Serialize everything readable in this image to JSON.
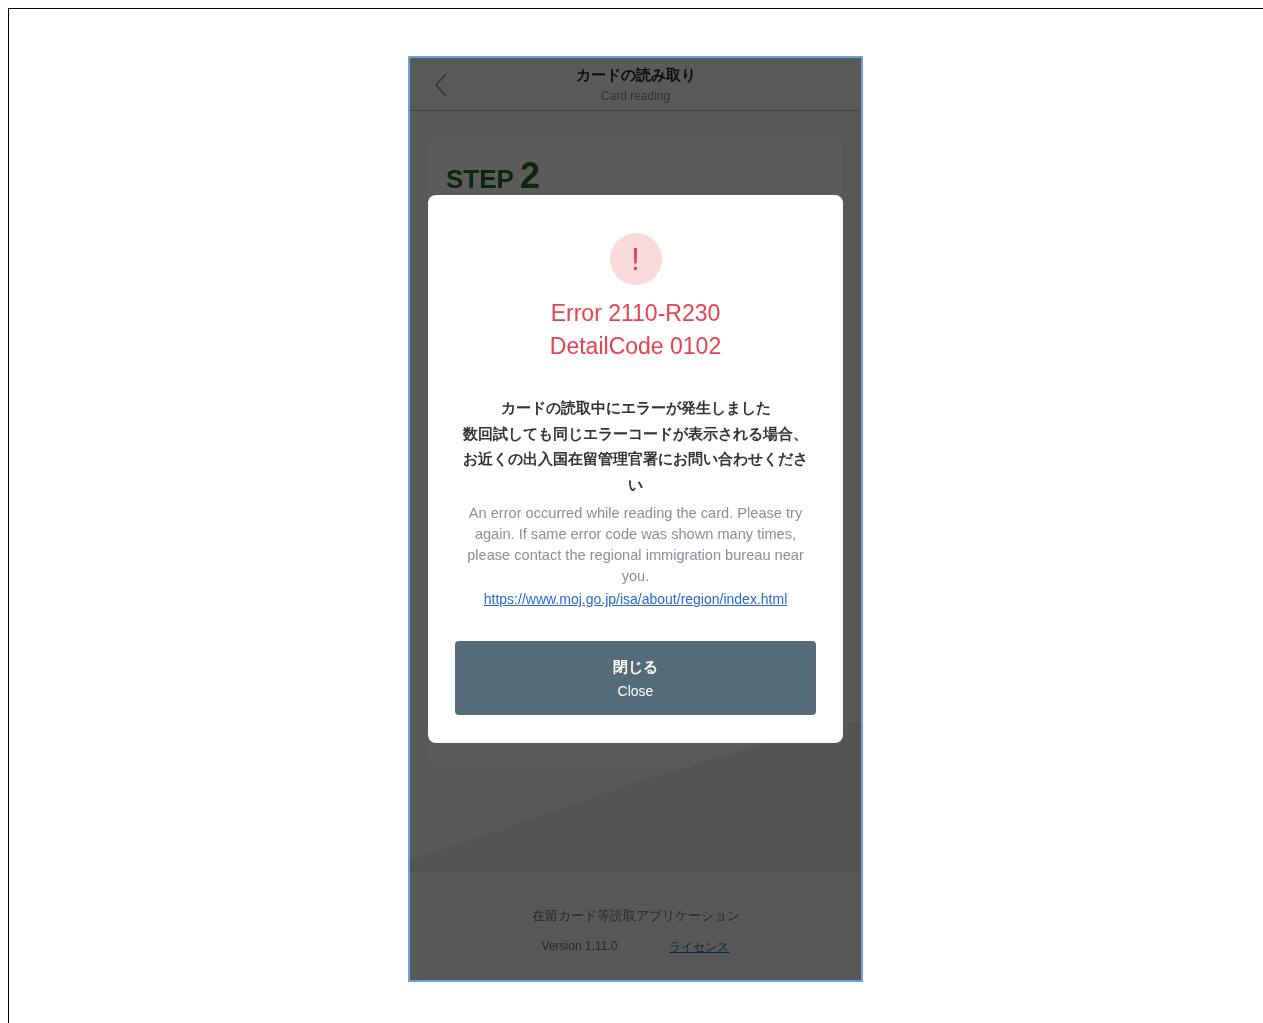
{
  "header": {
    "title": "カードの読み取り",
    "subtitle": "Card reading"
  },
  "step": {
    "label": "STEP",
    "number": "2"
  },
  "dialog": {
    "icon_text": "!",
    "error_lines": [
      "Error 2110-R230",
      "DetailCode 0102"
    ],
    "message_ja": [
      "カードの読取中にエラーが発生しました",
      "数回試しても同じエラーコードが表示される場合、お近くの出入国在留管理官署にお問い合わせください"
    ],
    "message_en": "An error occurred while reading the card. Please try again. If same error code was shown many times, please contact the regional immigration bureau near you.",
    "link": "https://www.moj.go.jp/isa/about/region/index.html",
    "button": {
      "label_ja": "閉じる",
      "label_en": "Close"
    }
  },
  "footer": {
    "app_name": "在留カード等読取アプリケーション",
    "version": "Version 1.11.0",
    "license_link": "ライセンス"
  }
}
